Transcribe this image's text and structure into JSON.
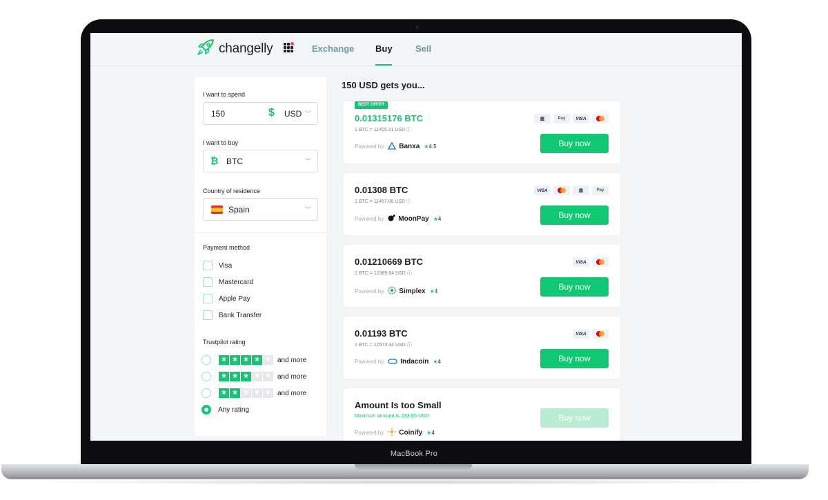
{
  "device": {
    "label": "MacBook Pro"
  },
  "header": {
    "logo_text": "changelly",
    "nav": [
      {
        "label": "Exchange",
        "active": false
      },
      {
        "label": "Buy",
        "active": true
      },
      {
        "label": "Sell",
        "active": false
      }
    ]
  },
  "filters": {
    "spend_label": "I want to spend",
    "spend_amount": "150",
    "spend_currency_symbol": "$",
    "spend_currency": "USD",
    "buy_label": "I want to buy",
    "buy_currency_symbol": "₿",
    "buy_currency": "BTC",
    "country_label": "Country of residence",
    "country": "Spain",
    "payment_label": "Payment method",
    "payment_methods": [
      "Visa",
      "Mastercard",
      "Apple Pay",
      "Bank Transfer"
    ],
    "trustpilot_label": "Trustpilot rating",
    "rating_options": [
      {
        "stars": 4,
        "label": "and more",
        "selected": false
      },
      {
        "stars": 3,
        "label": "and more",
        "selected": false
      },
      {
        "stars": 2,
        "label": "and more",
        "selected": false
      },
      {
        "stars": 0,
        "label": "Any rating",
        "selected": true
      }
    ]
  },
  "offers": {
    "heading": "150 USD gets you...",
    "powered_by": "Powered by",
    "items": [
      {
        "badge": "BEST OFFER",
        "amount": "0.01315176 BTC",
        "rate": "1 BTC = 11405.31 USD",
        "provider": "Banxa",
        "rating": "4.5",
        "payment": [
          "bank",
          "applepay",
          "visa",
          "mastercard"
        ],
        "button": "Buy now"
      },
      {
        "amount": "0.01308 BTC",
        "rate": "1 BTC = 11467.88 USD",
        "provider": "MoonPay",
        "rating": "4",
        "payment": [
          "visa",
          "mastercard",
          "bank",
          "applepay"
        ],
        "button": "Buy now"
      },
      {
        "amount": "0.01210669 BTC",
        "rate": "1 BTC = 12389.84 USD",
        "provider": "Simplex",
        "rating": "4",
        "payment": [
          "visa",
          "mastercard"
        ],
        "button": "Buy now"
      },
      {
        "amount": "0.01193 BTC",
        "rate": "1 BTC = 12573.34 USD",
        "provider": "Indacoin",
        "rating": "4",
        "payment": [
          "visa",
          "mastercard"
        ],
        "button": "Buy now"
      },
      {
        "amount": "Amount Is too Small",
        "rate": "Minimum amount is 233.85 USD",
        "provider": "Coinify",
        "rating": "4",
        "payment": [],
        "button": "Buy now",
        "disabled": true
      }
    ]
  },
  "colors": {
    "accent": "#11c872",
    "nav_inactive": "#6d9ca3",
    "text": "#1b1f23"
  },
  "icons": [
    "rocket-logo-icon",
    "apps-grid-icon",
    "dollar-icon",
    "bitcoin-icon",
    "spain-flag-icon",
    "chevron-down-icon",
    "star-icon",
    "bank-icon",
    "apple-pay-icon",
    "visa-icon",
    "mastercard-icon",
    "banxa-icon",
    "moonpay-icon",
    "simplex-icon",
    "indacoin-icon",
    "coinify-icon",
    "info-icon"
  ]
}
